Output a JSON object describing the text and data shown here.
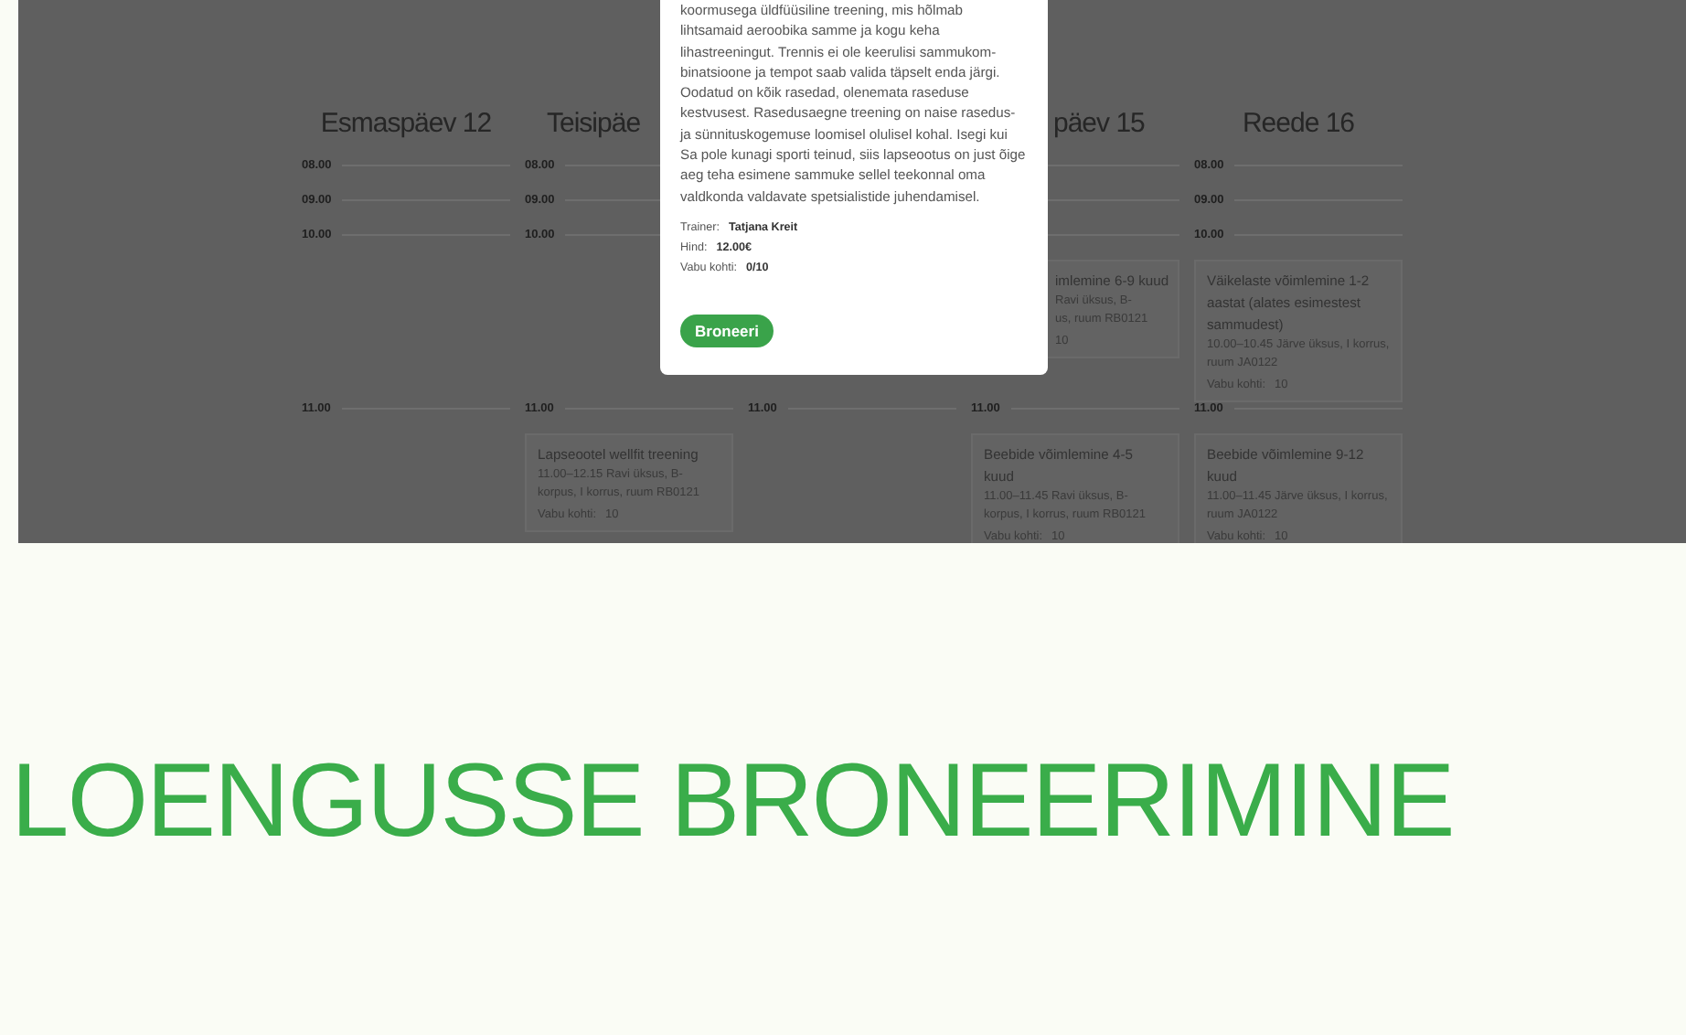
{
  "calendar": {
    "columns": [
      {
        "header": "Esmaspäev 12",
        "slots": [
          {
            "time": "08.00"
          },
          {
            "time": "09.00"
          },
          {
            "time": "10.00"
          },
          {
            "time": "11.00"
          }
        ]
      },
      {
        "header": "Teisipäe",
        "slots": [
          {
            "time": "08.00"
          },
          {
            "time": "09.00"
          },
          {
            "time": "10.00"
          },
          {
            "time": "11.00",
            "events": [
              {
                "title": "Lapseootel wellfit treening",
                "details": [
                  "11.00–12.15 Ravi üksus, B-korpus, I korrus, ruum RB0121"
                ],
                "seats_label": "Vabu kohti:",
                "seats": "10"
              }
            ]
          }
        ]
      },
      {
        "slots": [
          {
            "time": "11.00"
          }
        ]
      },
      {
        "header": "päev 15",
        "slots": [
          {
            "events": [
              {
                "title": "imlemine 6-9 kuud",
                "details": [
                  "Ravi üksus, B-",
                  "us, ruum RB0121"
                ],
                "seats": "10"
              }
            ]
          },
          {
            "time": "11.00",
            "events": [
              {
                "title": "Beebide võimlemine 4-5 kuud",
                "details": [
                  "11.00–11.45 Ravi üksus, B-korpus, I korrus, ruum RB0121"
                ],
                "seats_label": "Vabu kohti:",
                "seats": "10"
              }
            ]
          }
        ]
      },
      {
        "header": "Reede 16",
        "slots": [
          {
            "time": "08.00"
          },
          {
            "time": "09.00"
          },
          {
            "time": "10.00",
            "events": [
              {
                "title": "Väikelaste võimlemine 1-2 aastat (alates esimestest sammudest)",
                "details": [
                  "10.00–10.45 Järve üksus, I korrus, ruum JA0122"
                ],
                "seats_label": "Vabu kohti:",
                "seats": "10"
              }
            ]
          },
          {
            "time": "11.00",
            "events": [
              {
                "title": "Beebide võimlemine 9-12 kuud",
                "details": [
                  "11.00–11.45 Järve üksus, I korrus, ruum JA0122"
                ],
                "seats_label": "Vabu kohti:",
                "seats": "10"
              }
            ]
          }
        ]
      }
    ]
  },
  "modal": {
    "description": "koormusega üldfüüsiline treening, mis hõlmab\nlihtsamaid aeroobika samme ja kogu keha\nlihastreeningut. Trennis ei ole keerulisi sammukom-\nbinatsioone ja tempot saab valida täpselt enda järgi.\nOodatud on kõik rasedad, olenemata raseduse\nkestvusest. Rasedusaegne treening on naise rasedus-\nja sünnituskogemuse loomisel olulisel kohal. Isegi kui\nSa pole kunagi sporti teinud, siis lapseootus on just õige\naeg teha esimene sammuke sellel teekonnal oma\nvaldkonda valdavate spetsialistide juhendamisel.",
    "details": [
      {
        "label": "Trainer:",
        "value": "Tatjana Kreit"
      },
      {
        "label": "Hind:",
        "value": "12.00€"
      },
      {
        "label": "Vabu kohti:",
        "value": "0/10"
      }
    ],
    "button": "Broneeri"
  },
  "section_title": "LOENGUSSE BRONEERIMINE"
}
